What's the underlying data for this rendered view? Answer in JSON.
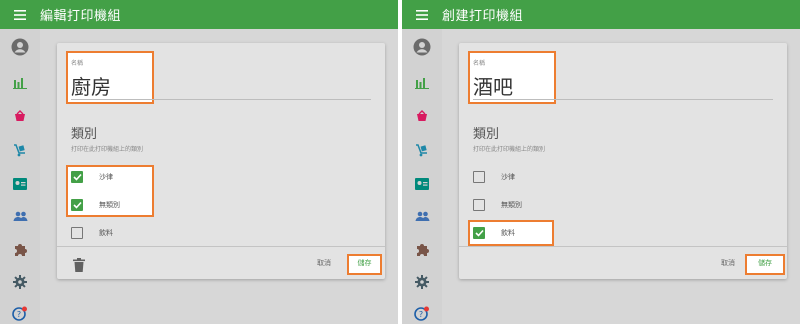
{
  "colors": {
    "appbar": "#43a047",
    "highlight": "#ed7d31",
    "checked": "#43a047"
  },
  "left": {
    "title": "編輯打印機組",
    "name_label": "名稱",
    "name_value": "廚房",
    "category_title": "類別",
    "category_desc": "打印在此打印機組上的類別",
    "options": [
      {
        "label": "沙律",
        "checked": true
      },
      {
        "label": "無類別",
        "checked": true
      },
      {
        "label": "飲料",
        "checked": false
      }
    ],
    "cancel_label": "取消",
    "save_label": "儲存"
  },
  "right": {
    "title": "創建打印機組",
    "name_label": "名稱",
    "name_value": "酒吧",
    "category_title": "類別",
    "category_desc": "打印在此打印機組上的類別",
    "options": [
      {
        "label": "沙律",
        "checked": false
      },
      {
        "label": "無類別",
        "checked": false
      },
      {
        "label": "飲料",
        "checked": true
      }
    ],
    "cancel_label": "取消",
    "save_label": "儲存"
  },
  "sidebar_icons": [
    "account-circle-icon",
    "bar-chart-icon",
    "basket-icon",
    "delivery-icon",
    "id-card-icon",
    "people-icon",
    "puzzle-icon",
    "gear-icon",
    "help-icon"
  ]
}
